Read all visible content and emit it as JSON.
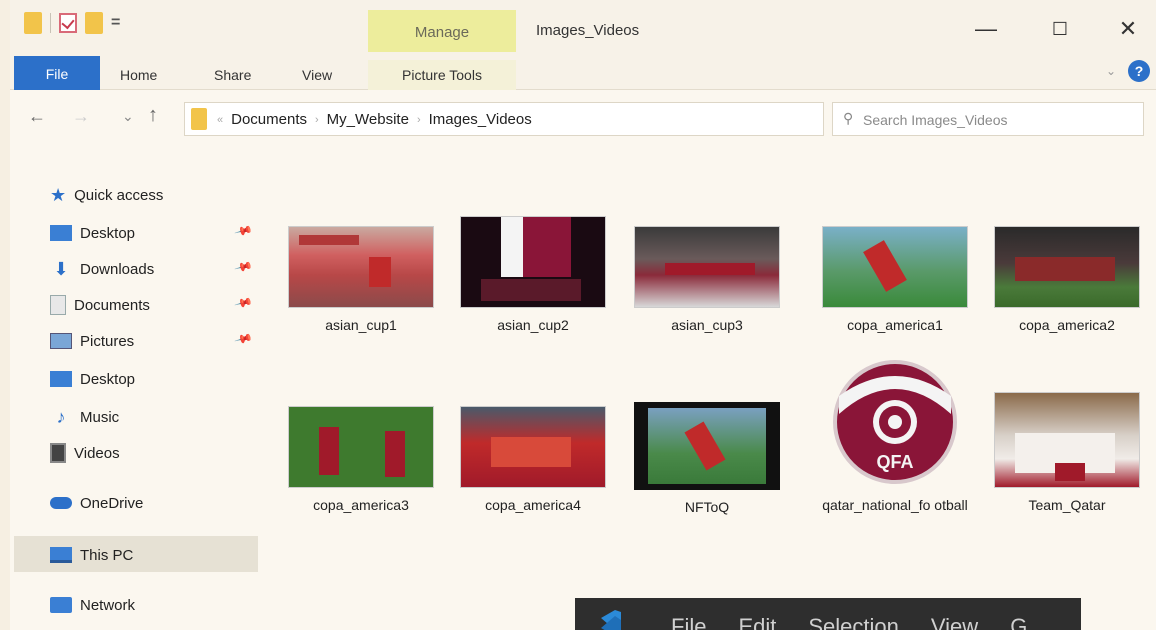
{
  "window": {
    "title": "Images_Videos",
    "contextual_tab": "Manage",
    "controls": {
      "minimize": "—",
      "maximize": "☐",
      "close": "✕"
    }
  },
  "ribbon": {
    "tabs": [
      "File",
      "Home",
      "Share",
      "View",
      "Picture Tools"
    ],
    "help": "?"
  },
  "address": {
    "prefix": "«",
    "crumbs": [
      "Documents",
      "My_Website",
      "Images_Videos"
    ],
    "search_placeholder": "Search Images_Videos"
  },
  "nav_pane": {
    "quick_access": "Quick access",
    "pinned": [
      "Desktop",
      "Downloads",
      "Documents",
      "Pictures"
    ],
    "other": [
      "Desktop",
      "Music",
      "Videos"
    ],
    "onedrive": "OneDrive",
    "this_pc": "This PC",
    "network": "Network"
  },
  "files": [
    {
      "name": "asian_cup1",
      "kind": "image"
    },
    {
      "name": "asian_cup2",
      "kind": "image"
    },
    {
      "name": "asian_cup3",
      "kind": "image"
    },
    {
      "name": "copa_america1",
      "kind": "image"
    },
    {
      "name": "copa_america2",
      "kind": "image"
    },
    {
      "name": "copa_america3",
      "kind": "image"
    },
    {
      "name": "copa_america4",
      "kind": "image"
    },
    {
      "name": "NFToQ",
      "kind": "video"
    },
    {
      "name": "qatar_national_fo otball",
      "kind": "logo"
    },
    {
      "name": "Team_Qatar",
      "kind": "image"
    }
  ],
  "logo_text": "QFA",
  "vscode_menu": [
    "File",
    "Edit",
    "Selection",
    "View",
    "G"
  ],
  "colors": {
    "file_tab": "#2c70c9",
    "manage_tab": "#eded9c",
    "folder": "#f2c44a",
    "maroon": "#8a1538"
  }
}
